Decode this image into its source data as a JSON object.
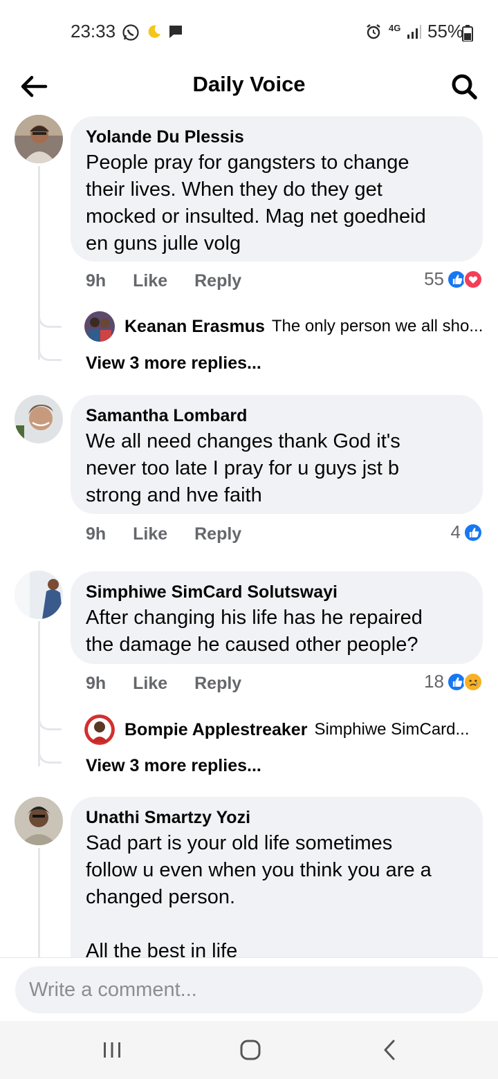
{
  "status_bar": {
    "time": "23:33",
    "network": "4G",
    "battery": "55%"
  },
  "header": {
    "title": "Daily Voice"
  },
  "comments": [
    {
      "author": "Yolande Du Plessis",
      "text": "People pray for gangsters to change\ntheir lives. When they do they get\nmocked or insulted. Mag net goedheid\nen guns julle volg",
      "time": "9h",
      "like_label": "Like",
      "reply_label": "Reply",
      "reaction_count": "55",
      "reactions": [
        "like-icon",
        "love-icon"
      ],
      "reply_preview": {
        "author": "Keanan Erasmus",
        "text": "The only person we all sho..."
      },
      "more_replies": "View 3 more replies..."
    },
    {
      "author": "Samantha Lombard",
      "text": "We all need changes thank God it's\nnever too late I pray for u guys jst b\nstrong and hve faith",
      "time": "9h",
      "like_label": "Like",
      "reply_label": "Reply",
      "reaction_count": "4",
      "reactions": [
        "like-icon"
      ]
    },
    {
      "author": "Simphiwe SimCard Solutswayi",
      "text": "After changing his life has he repaired\nthe damage he caused other people?",
      "time": "9h",
      "like_label": "Like",
      "reply_label": "Reply",
      "reaction_count": "18",
      "reactions": [
        "like-icon",
        "sad-icon"
      ],
      "reply_preview": {
        "author": "Bompie Applestreaker",
        "text": "Simphiwe SimCard..."
      },
      "more_replies": "View 3 more replies..."
    },
    {
      "author": "Unathi Smartzy Yozi",
      "text": "Sad part is your old life sometimes\nfollow u even when you think you are a\nchanged person.\n\nAll the best in life"
    }
  ],
  "composer": {
    "placeholder": "Write a comment..."
  },
  "colors": {
    "bubble": "#f0f2f5",
    "like_blue": "#1877f2",
    "love_red": "#f33e58",
    "sad_yellow": "#f7b125",
    "secondary_text": "#65676b"
  }
}
